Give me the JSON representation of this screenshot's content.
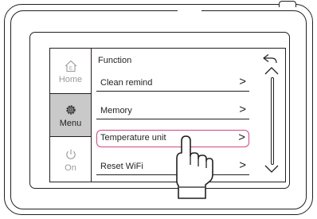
{
  "sidebar": {
    "items": [
      {
        "label": "Home",
        "icon": "home-icon",
        "active": false
      },
      {
        "label": "Menu",
        "icon": "gear-icon",
        "active": true
      },
      {
        "label": "On",
        "icon": "power-icon",
        "active": false
      }
    ]
  },
  "main": {
    "title": "Function",
    "items": [
      {
        "label": "Clean remind",
        "chevron": ">"
      },
      {
        "label": "Memory",
        "chevron": ">"
      },
      {
        "label": "Temperature unit",
        "chevron": ">",
        "selected": true
      },
      {
        "label": "Reset WiFi",
        "chevron": ">"
      }
    ]
  },
  "controls": {
    "back_icon": "back-arrow-icon",
    "scroll_up_icon": "chevron-up-icon",
    "scroll_down_icon": "chevron-down-icon"
  },
  "colors": {
    "outline": "#231f20",
    "selection": "#d6457f",
    "menu_active_bg": "#c9c9c9",
    "inactive_label": "#9a9a9a"
  }
}
